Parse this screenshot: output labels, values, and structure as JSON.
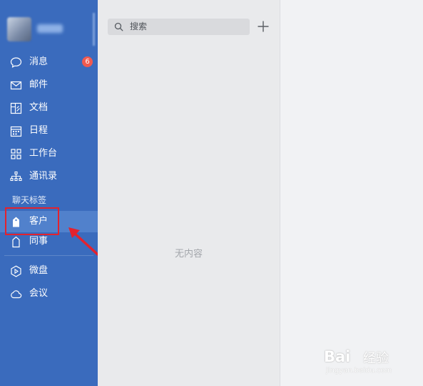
{
  "sidebar": {
    "nav": [
      {
        "label": "消息",
        "icon": "chat-bubble-icon",
        "badge": "6"
      },
      {
        "label": "邮件",
        "icon": "mail-icon"
      },
      {
        "label": "文档",
        "icon": "document-icon"
      },
      {
        "label": "日程",
        "icon": "calendar-icon"
      },
      {
        "label": "工作台",
        "icon": "grid-icon"
      },
      {
        "label": "通讯录",
        "icon": "org-chart-icon"
      }
    ],
    "chat_tags_title": "聊天标签",
    "tags": [
      {
        "label": "客户",
        "icon": "tag-filled-icon",
        "active": true
      },
      {
        "label": "同事",
        "icon": "tag-outline-icon"
      }
    ],
    "tools": [
      {
        "label": "微盘",
        "icon": "drive-icon"
      },
      {
        "label": "会议",
        "icon": "cloud-icon"
      }
    ]
  },
  "middle": {
    "search_placeholder": "搜索",
    "empty_text": "无内容"
  },
  "watermark": {
    "brand": "Bai",
    "suffix": "经验",
    "url": "jingyan.baidu.com"
  },
  "colors": {
    "sidebar": "#3a6bbd",
    "active_item": "#5181cc",
    "badge": "#f05a50",
    "annotation": "#e3222e"
  }
}
